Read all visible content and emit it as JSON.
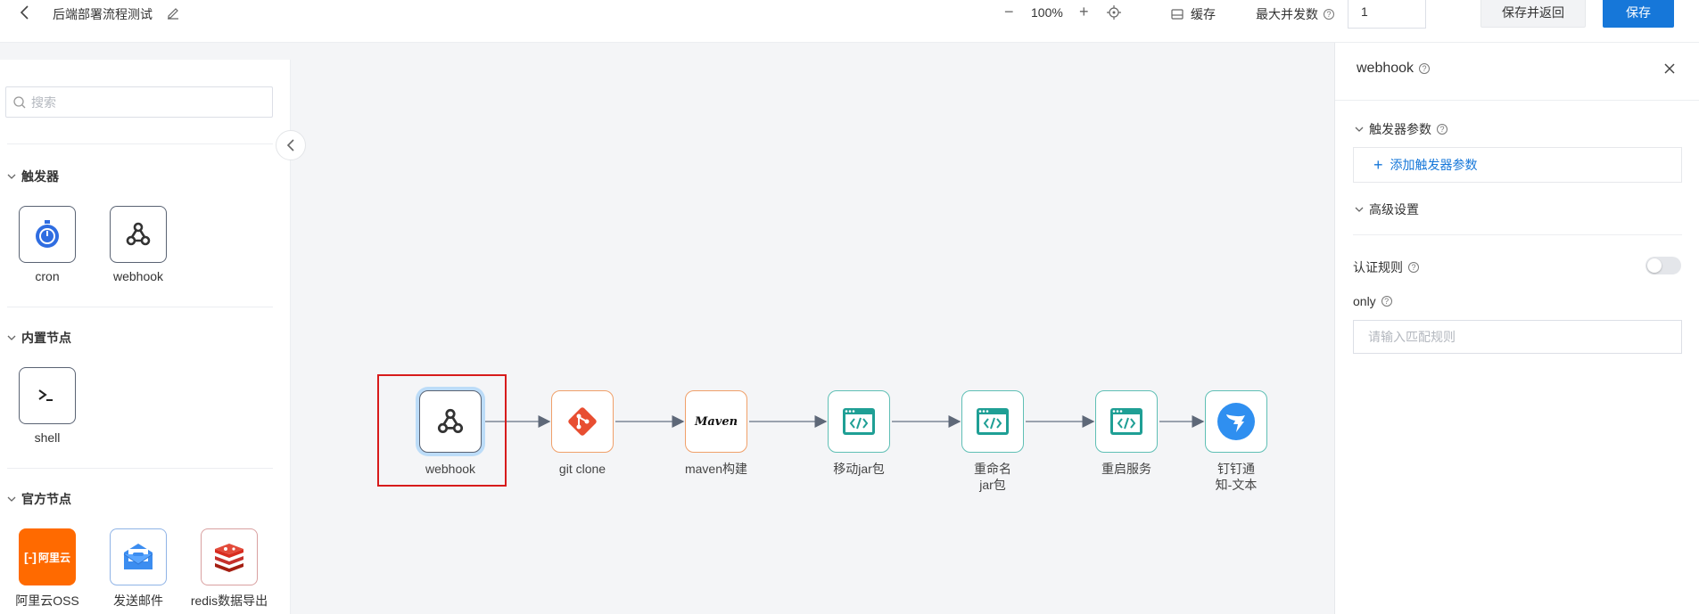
{
  "header": {
    "title": "后端部署流程测试",
    "zoom": "100%",
    "cache_label": "缓存",
    "max_concurrency_label": "最大并发数",
    "max_concurrency_value": "1",
    "save_return_label": "保存并返回",
    "save_label": "保存",
    "accent": "#1677d9"
  },
  "sidebar": {
    "search_placeholder": "搜索",
    "sections": [
      {
        "title": "触发器",
        "items": [
          {
            "label": "cron",
            "icon": "stopwatch-icon"
          },
          {
            "label": "webhook",
            "icon": "webhook-icon"
          }
        ]
      },
      {
        "title": "内置节点",
        "items": [
          {
            "label": "shell",
            "icon": "terminal-icon"
          }
        ]
      },
      {
        "title": "官方节点",
        "items": [
          {
            "label": "阿里云OSS",
            "icon": "aliyun-icon",
            "logo": "阿里云"
          },
          {
            "label": "发送邮件",
            "icon": "mail-icon"
          },
          {
            "label": "redis数据导出",
            "icon": "redis-icon"
          }
        ]
      }
    ]
  },
  "flow": {
    "nodes": [
      {
        "label": "webhook",
        "icon": "webhook-icon"
      },
      {
        "label": "git clone",
        "icon": "git-icon"
      },
      {
        "label": "maven构建",
        "icon": "maven-icon",
        "logo": "Maven"
      },
      {
        "label": "移动jar包",
        "icon": "code-window-icon"
      },
      {
        "label": "重命名jar包",
        "icon": "code-window-icon"
      },
      {
        "label": "重启服务",
        "icon": "code-window-icon"
      },
      {
        "label": "钉钉通知-文本",
        "icon": "dingtalk-icon"
      }
    ]
  },
  "panel": {
    "title": "webhook",
    "trigger_params_label": "触发器参数",
    "add_param_label": "添加触发器参数",
    "advanced_label": "高级设置",
    "auth_rule_label": "认证规则",
    "only_label": "only",
    "only_placeholder": "请输入匹配规则"
  }
}
